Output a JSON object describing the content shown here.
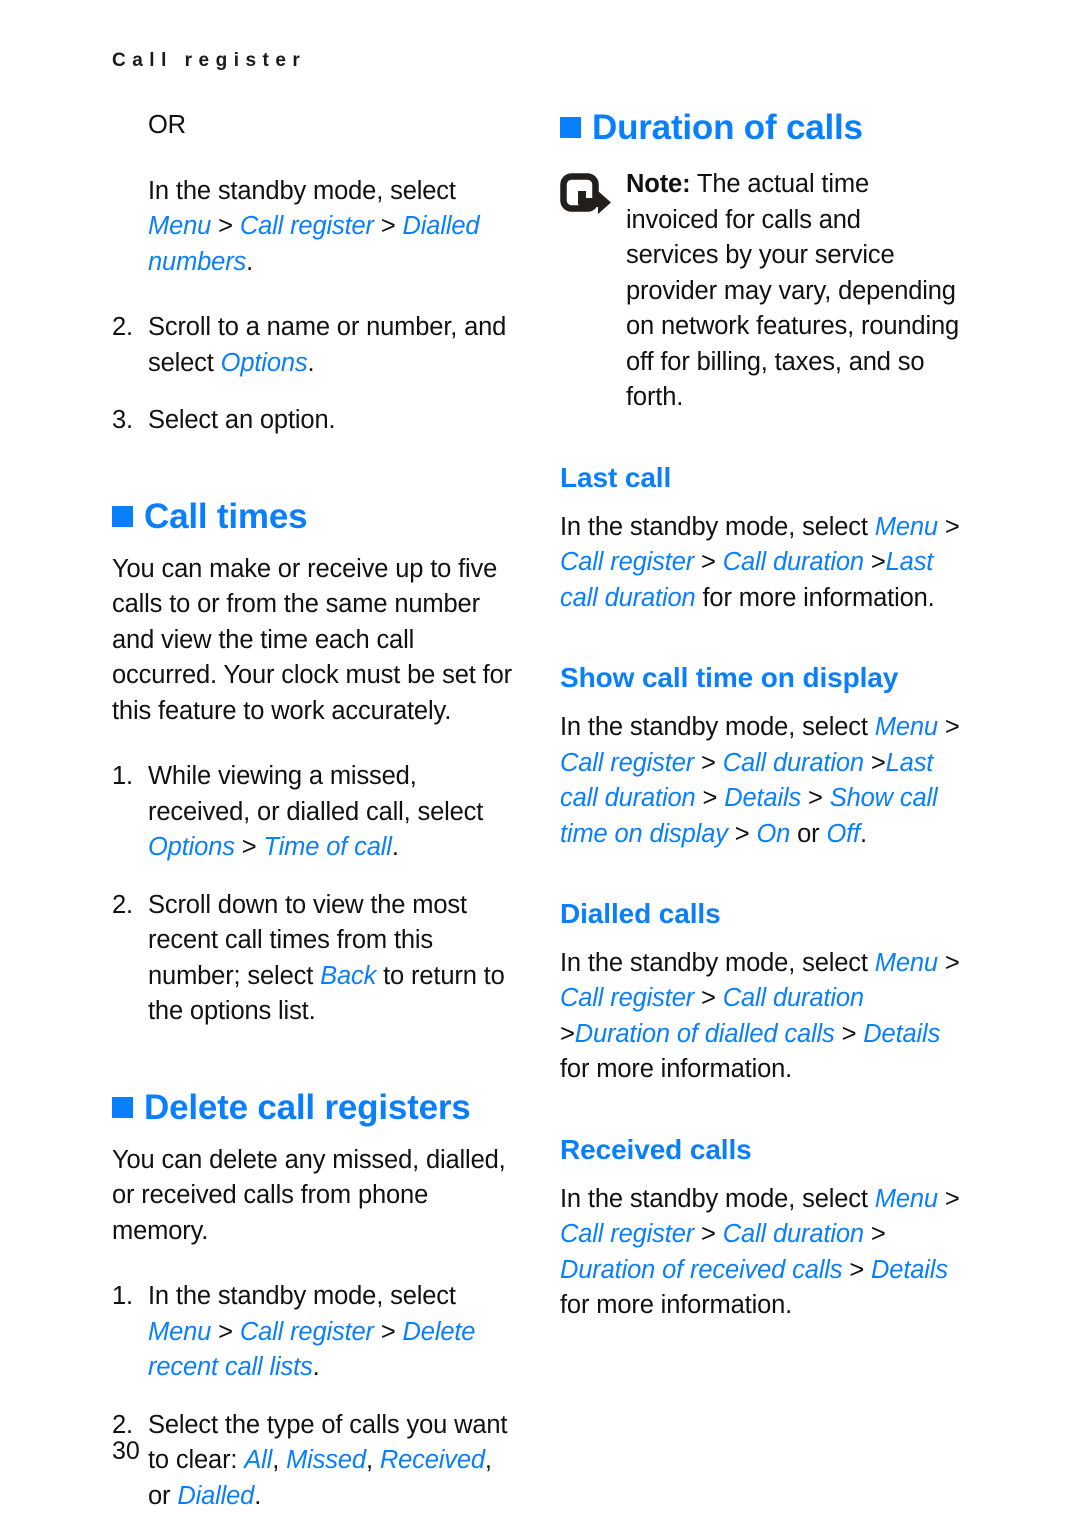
{
  "running_header": "Call register",
  "page_number": "30",
  "colors": {
    "accent_blue": "#0a7ffc",
    "body_black": "#111111",
    "page_background": "#ffffff"
  },
  "left_column": {
    "or_label": "OR",
    "intro": {
      "lead": "In the standby mode, select ",
      "path": [
        {
          "text": "Menu",
          "style": "ui"
        },
        {
          "text": " > ",
          "style": "sep"
        },
        {
          "text": "Call register",
          "style": "ui"
        },
        {
          "text": " > ",
          "style": "sep"
        },
        {
          "text": "Dialled numbers",
          "style": "ui"
        },
        {
          "text": ".",
          "style": "sep"
        }
      ]
    },
    "steps_top": [
      {
        "num": "2.",
        "parts": [
          {
            "text": "Scroll to a name or number, and select ",
            "style": "plain"
          },
          {
            "text": "Options",
            "style": "ui"
          },
          {
            "text": ".",
            "style": "plain"
          }
        ]
      },
      {
        "num": "3.",
        "parts": [
          {
            "text": "Select an option.",
            "style": "plain"
          }
        ]
      }
    ],
    "call_times": {
      "heading": "Call times",
      "intro": "You can make or receive up to five calls to or from the same number and view the time each call occurred. Your clock must be set for this feature to work accurately.",
      "steps": [
        {
          "num": "1.",
          "parts": [
            {
              "text": "While viewing a missed, received, or dialled call, select ",
              "style": "plain"
            },
            {
              "text": "Options",
              "style": "ui"
            },
            {
              "text": " > ",
              "style": "sep"
            },
            {
              "text": "Time of call",
              "style": "ui"
            },
            {
              "text": ".",
              "style": "plain"
            }
          ]
        },
        {
          "num": "2.",
          "parts": [
            {
              "text": "Scroll down to view the most recent call times from this number; select ",
              "style": "plain"
            },
            {
              "text": "Back",
              "style": "ui"
            },
            {
              "text": " to return to the options list.",
              "style": "plain"
            }
          ]
        }
      ]
    },
    "delete_call_registers": {
      "heading": "Delete call registers",
      "intro": "You can delete any missed, dialled, or received calls from phone memory.",
      "steps": [
        {
          "num": "1.",
          "parts": [
            {
              "text": "In the standby mode, select ",
              "style": "plain"
            },
            {
              "text": "Menu",
              "style": "ui"
            },
            {
              "text": " > ",
              "style": "sep"
            },
            {
              "text": "Call register",
              "style": "ui"
            },
            {
              "text": " > ",
              "style": "sep"
            },
            {
              "text": "Delete recent call lists",
              "style": "ui"
            },
            {
              "text": ".",
              "style": "plain"
            }
          ]
        },
        {
          "num": "2.",
          "parts": [
            {
              "text": "Select the type of calls you want to clear: ",
              "style": "plain"
            },
            {
              "text": "All",
              "style": "ui"
            },
            {
              "text": ", ",
              "style": "plain"
            },
            {
              "text": "Missed",
              "style": "ui"
            },
            {
              "text": ", ",
              "style": "plain"
            },
            {
              "text": "Received",
              "style": "ui"
            },
            {
              "text": ", or ",
              "style": "plain"
            },
            {
              "text": "Dialled",
              "style": "ui"
            },
            {
              "text": ".",
              "style": "plain"
            }
          ]
        }
      ]
    }
  },
  "right_column": {
    "duration_of_calls": {
      "heading": "Duration of calls",
      "note": {
        "icon": "note-arrow-icon",
        "label": "Note:",
        "text": " The actual time invoiced for calls and services by your service provider may vary, depending on network features, rounding off for billing, taxes, and so forth."
      }
    },
    "last_call": {
      "heading": "Last call",
      "parts": [
        {
          "text": "In the standby mode, select ",
          "style": "plain"
        },
        {
          "text": "Menu",
          "style": "ui"
        },
        {
          "text": " > ",
          "style": "sep"
        },
        {
          "text": "Call register",
          "style": "ui"
        },
        {
          "text": " > ",
          "style": "sep"
        },
        {
          "text": "Call duration",
          "style": "ui"
        },
        {
          "text": " >",
          "style": "sep"
        },
        {
          "text": "Last call duration",
          "style": "ui"
        },
        {
          "text": " for more information.",
          "style": "plain"
        }
      ]
    },
    "show_call_time_on_display": {
      "heading": "Show call time on display",
      "parts": [
        {
          "text": "In the standby mode, select ",
          "style": "plain"
        },
        {
          "text": "Menu",
          "style": "ui"
        },
        {
          "text": " > ",
          "style": "sep"
        },
        {
          "text": "Call register",
          "style": "ui"
        },
        {
          "text": " > ",
          "style": "sep"
        },
        {
          "text": "Call duration",
          "style": "ui"
        },
        {
          "text": " >",
          "style": "sep"
        },
        {
          "text": "Last call duration",
          "style": "ui"
        },
        {
          "text": " > ",
          "style": "sep"
        },
        {
          "text": "Details",
          "style": "ui"
        },
        {
          "text": " > ",
          "style": "sep"
        },
        {
          "text": "Show call time on display",
          "style": "ui"
        },
        {
          "text": " > ",
          "style": "sep"
        },
        {
          "text": "On",
          "style": "ui"
        },
        {
          "text": " or ",
          "style": "plain"
        },
        {
          "text": "Off",
          "style": "ui"
        },
        {
          "text": ".",
          "style": "plain"
        }
      ]
    },
    "dialled_calls": {
      "heading": "Dialled calls",
      "parts": [
        {
          "text": "In the standby mode, select ",
          "style": "plain"
        },
        {
          "text": "Menu",
          "style": "ui"
        },
        {
          "text": " > ",
          "style": "sep"
        },
        {
          "text": "Call register",
          "style": "ui"
        },
        {
          "text": " > ",
          "style": "sep"
        },
        {
          "text": "Call duration",
          "style": "ui"
        },
        {
          "text": " >",
          "style": "sep"
        },
        {
          "text": "Duration of dialled calls",
          "style": "ui"
        },
        {
          "text": " > ",
          "style": "sep"
        },
        {
          "text": "Details",
          "style": "ui"
        },
        {
          "text": " for more information.",
          "style": "plain"
        }
      ]
    },
    "received_calls": {
      "heading": "Received calls",
      "parts": [
        {
          "text": "In the standby mode, select ",
          "style": "plain"
        },
        {
          "text": "Menu",
          "style": "ui"
        },
        {
          "text": " > ",
          "style": "sep"
        },
        {
          "text": "Call register",
          "style": "ui"
        },
        {
          "text": " > ",
          "style": "sep"
        },
        {
          "text": "Call duration",
          "style": "ui"
        },
        {
          "text": " > ",
          "style": "sep"
        },
        {
          "text": "Duration of received calls",
          "style": "ui"
        },
        {
          "text": " > ",
          "style": "sep"
        },
        {
          "text": "Details",
          "style": "ui"
        },
        {
          "text": " for more information.",
          "style": "plain"
        }
      ]
    }
  }
}
